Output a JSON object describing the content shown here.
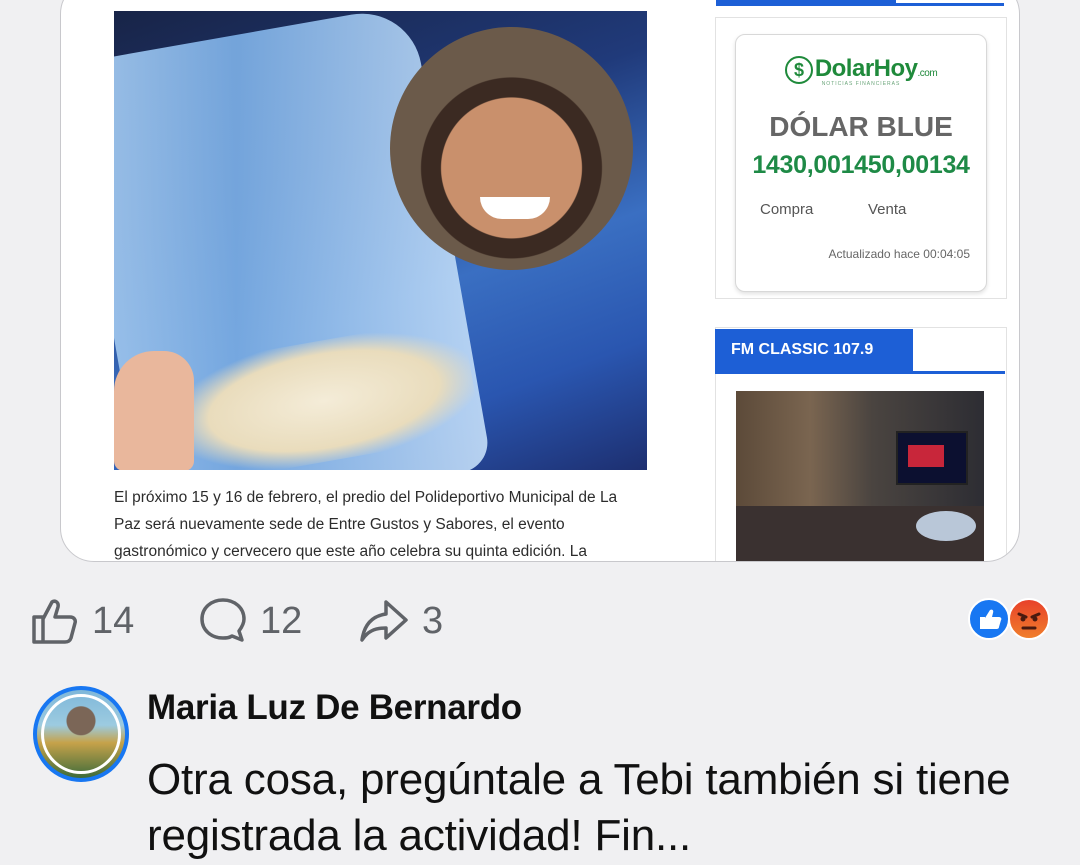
{
  "article": {
    "paragraph": "El próximo 15 y 16 de febrero, el predio del Polideportivo Municipal de La Paz será nuevamente sede de Entre Gustos y Sabores, el evento gastronómico y cervecero que este año celebra su quinta edición. La"
  },
  "dolar_widget": {
    "brand": "DolarHoy",
    "brand_suffix": ".com",
    "brand_tagline": "NOTICIAS FINANCIERAS",
    "title": "DÓLAR BLUE",
    "rates": "1430,001450,00134",
    "buy_label": "Compra",
    "sell_label": "Venta",
    "updated": "Actualizado hace 00:04:05"
  },
  "radio_widget": {
    "title": "FM CLASSIC 107.9"
  },
  "actions": {
    "likes": "14",
    "comments": "12",
    "shares": "3"
  },
  "comment": {
    "author": "Maria Luz De Bernardo",
    "text": "Otra cosa, pregúntale a Tebi también si tiene registrada la actividad! Fin..."
  },
  "colors": {
    "accent_blue": "#1d5fd6",
    "facebook_blue": "#1877f2",
    "dolar_green": "#1e8a46"
  },
  "icons": [
    "thumb-up-icon",
    "comment-icon",
    "share-icon",
    "like-reaction-icon",
    "angry-reaction-icon"
  ]
}
